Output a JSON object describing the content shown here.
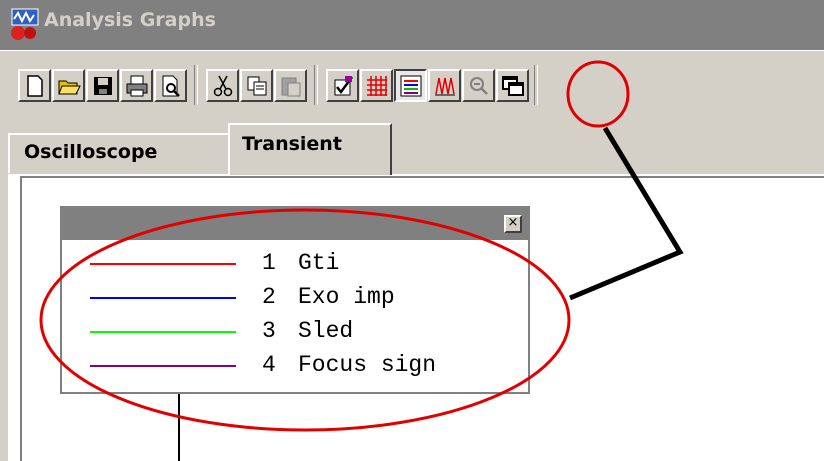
{
  "window": {
    "title": "Analysis Graphs",
    "app_icon": "analysis-app-icon"
  },
  "toolbar": {
    "buttons": [
      {
        "icon": "new-document-icon"
      },
      {
        "icon": "open-folder-icon"
      },
      {
        "icon": "save-disk-icon"
      },
      {
        "icon": "print-icon"
      },
      {
        "icon": "print-preview-icon"
      },
      {
        "icon": "cut-icon"
      },
      {
        "icon": "copy-icon"
      },
      {
        "icon": "paste-icon",
        "disabled": true
      },
      {
        "icon": "properties-check-icon"
      },
      {
        "icon": "grid-icon"
      },
      {
        "icon": "legend-icon",
        "highlighted": true
      },
      {
        "icon": "waveform-icon"
      },
      {
        "icon": "zoom-out-icon",
        "disabled": true
      },
      {
        "icon": "overlay-windows-icon"
      }
    ]
  },
  "tabs": [
    {
      "label": "Oscilloscope",
      "active": false
    },
    {
      "label": "Transient",
      "active": true
    }
  ],
  "legend": {
    "close_label": "×",
    "entries": [
      {
        "number": "1",
        "name": "Gti",
        "color": "#ff0000"
      },
      {
        "number": "2",
        "name": "Exo imp",
        "color": "#0000ff"
      },
      {
        "number": "3",
        "name": "Sled",
        "color": "#00ff00"
      },
      {
        "number": "4",
        "name": "Focus sign",
        "color": "#800080"
      }
    ]
  },
  "annotation": {
    "color": "#e00000",
    "connector_color": "#000000"
  }
}
